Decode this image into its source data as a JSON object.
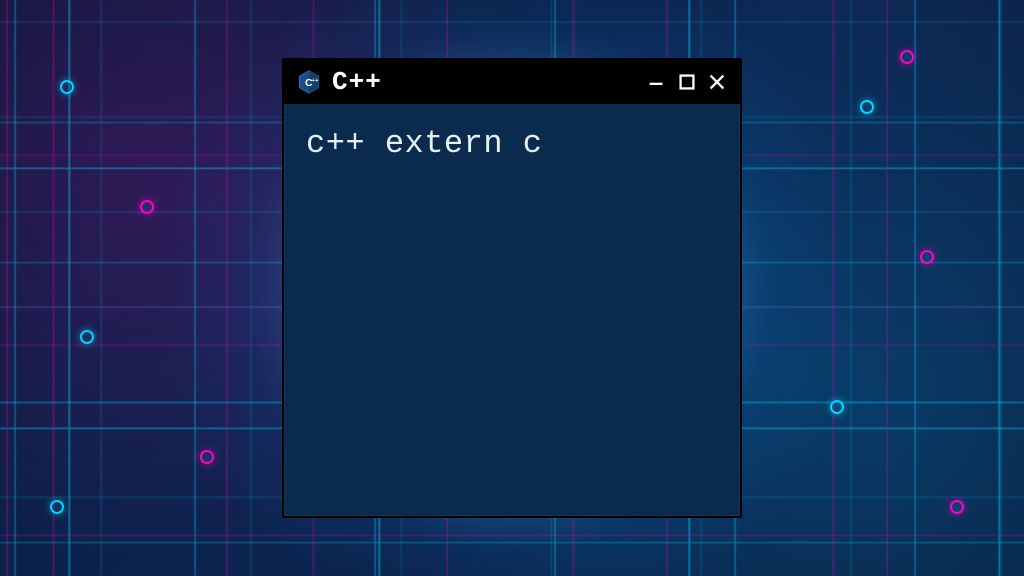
{
  "window": {
    "title": "C++",
    "icon_name": "cpp-hex-logo"
  },
  "content": {
    "line1": "c++ extern c"
  },
  "colors": {
    "window_bg": "#0b2b4e",
    "titlebar_bg": "#000000",
    "text": "#e8eef5",
    "glow": "#78beff",
    "circuit_cyan": "#00d4ff",
    "circuit_magenta": "#ff00c8"
  }
}
